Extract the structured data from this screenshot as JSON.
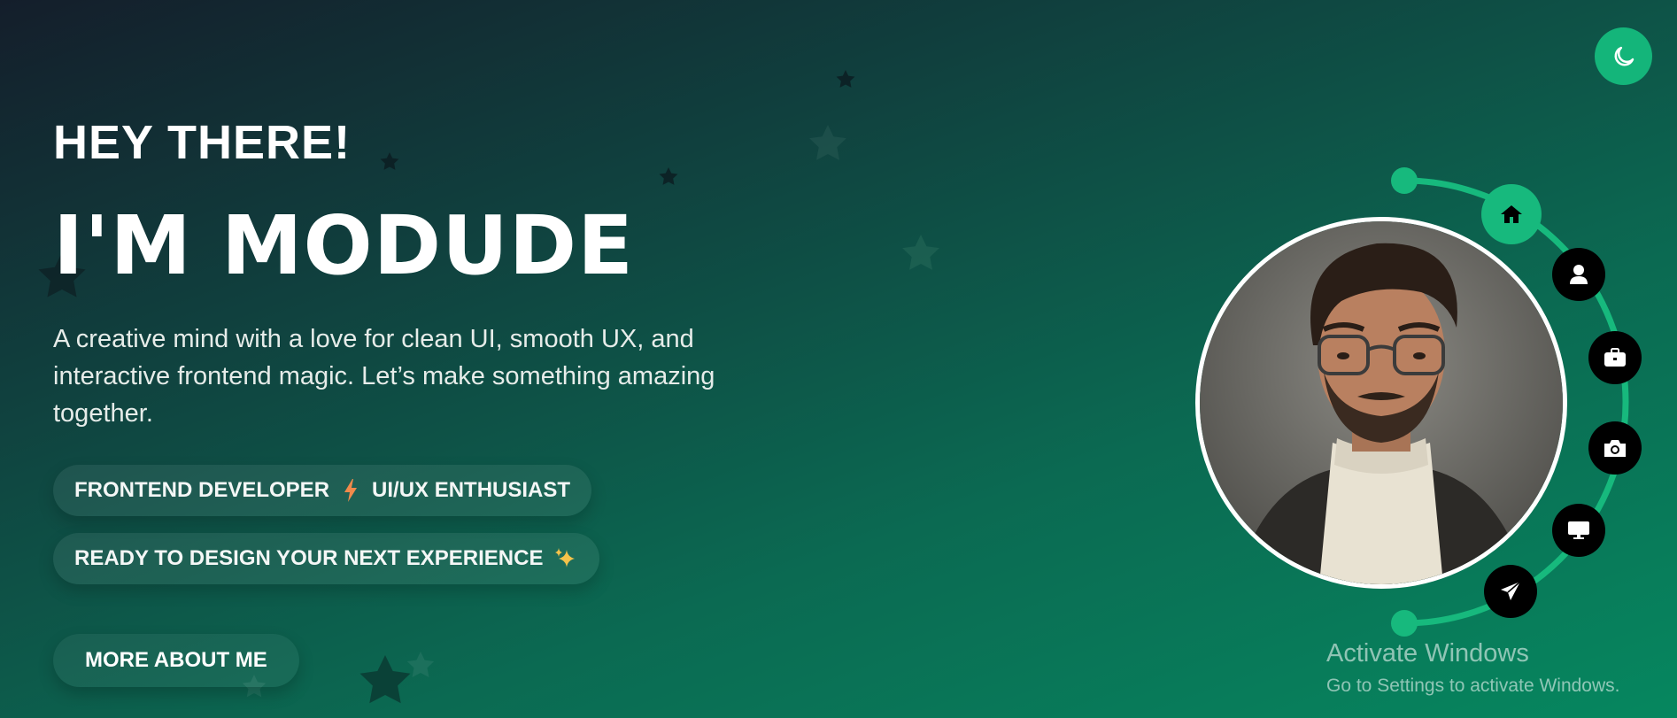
{
  "theme_toggle": {
    "icon": "moon-icon",
    "accent": "#14b57a"
  },
  "hero": {
    "greeting": "HEY THERE!",
    "name": "I'M MODUDE",
    "intro": "A creative mind with a love for clean UI, smooth UX, and interactive frontend magic. Let’s make something amazing together.",
    "tagline_roles": {
      "left": "FRONTEND DEVELOPER",
      "separator_icon": "lightning-bolt-icon",
      "right": "UI/UX ENTHUSIAST"
    },
    "tagline_ready": {
      "text": "READY TO DESIGN YOUR NEXT EXPERIENCE",
      "icon": "sparkles-icon"
    },
    "cta_label": "MORE ABOUT ME"
  },
  "profile": {
    "avatar_alt": "profile-photo",
    "nav": [
      {
        "icon": "home-icon",
        "active": true
      },
      {
        "icon": "user-icon",
        "active": false
      },
      {
        "icon": "briefcase-icon",
        "active": false
      },
      {
        "icon": "camera-icon",
        "active": false
      },
      {
        "icon": "monitor-icon",
        "active": false
      },
      {
        "icon": "paper-plane-icon",
        "active": false
      }
    ],
    "arc_color": "#17b97d"
  },
  "watermark": {
    "title": "Activate Windows",
    "subtitle": "Go to Settings to activate Windows."
  },
  "colors": {
    "background_start": "#141e2b",
    "background_end": "#06875f",
    "accent": "#17b97d"
  }
}
